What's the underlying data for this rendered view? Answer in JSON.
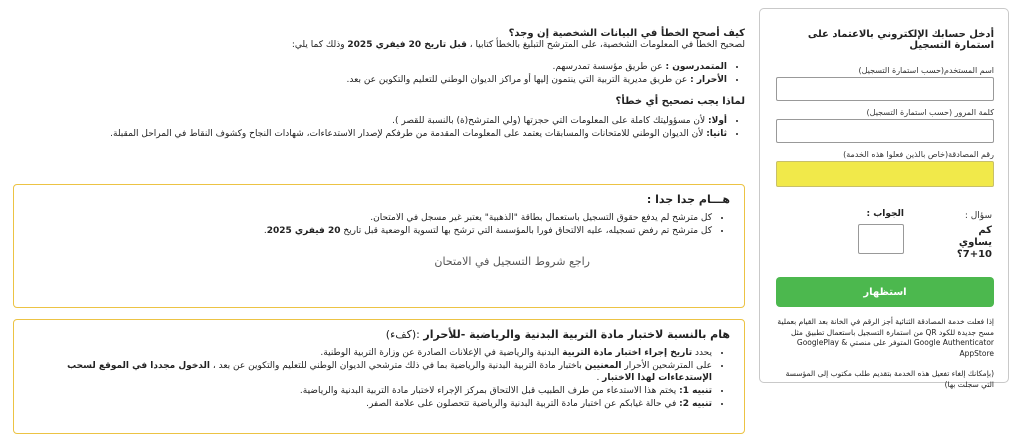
{
  "login": {
    "title": "أدخل حسابك الإلكتروني بالاعتماد على استمارة التسجيل",
    "username_label": "اسم المستخدم(حسب استمارة التسجيل)",
    "password_label": "كلمة المرور (حسب استمارة التسجيل)",
    "auth_label": "رقم المصادقة(خاص بالذين فعلوا هذه الخدمة)",
    "question_label": "سؤال :",
    "question_text": "كم يساوي 10+7؟",
    "answer_label": "الجواب :",
    "button_label": "استظهار",
    "note1": "إذا فعلت خدمة المصادقة الثنائية أجز الرقم في الخانة بعد القيام بعملية مسح جديدة للكود QR من استمارة التسجيل باستعمال تطبيق مثل Google Authenticator المتوفر على منصتي GooglePlay & AppStore",
    "note2": "(بإمكانك إلغاء تفعيل هذه الخدمة بتقديم طلب مكتوب إلى المؤسسة التي سجلت بها)"
  },
  "fix": {
    "heading": "كيف أصحح الخطأ في البيانات الشخصية إن وجد؟",
    "intro_a": "لصحيح الخطأ في المعلومات الشخصية، على المترشح التبليغ بالخطأ كتابيا ، ",
    "intro_b": "قبل تاريخ 20 فيفري 2025",
    "intro_c": " وذلك كما يلي:",
    "items": [
      {
        "bold": "المتمدرسون :",
        "text": " عن طريق مؤسسة تمدرسهم."
      },
      {
        "bold": "الأحرار :",
        "text": " عن طريق مديرية التربية التي ينتمون إليها أو مراكز الديوان الوطني للتعليم والتكوين عن بعد."
      }
    ]
  },
  "why": {
    "heading": "لماذا يجب تصحيح أي خطأ؟",
    "items": [
      {
        "bold": "أولا:",
        "text": " لأن مسؤوليتك كاملة على المعلومات التي حجزتها (ولي المترشح(ة) بالنسبة للقصر )."
      },
      {
        "bold": "ثانيا:",
        "text": " لأن الديوان الوطني للامتحانات والمسابقات يعتمد على المعلومات المقدمة من طرفكم لإصدار الاستدعاءات، شهادات النجاح وكشوف النقاط في المراحل المقبلة."
      }
    ]
  },
  "important": {
    "heading": "هـــام جدا جدا :",
    "item1": "كل مترشح لم يدفع حقوق التسجيل باستعمال بطاقة \"الذهبية\" يعتبر غير مسجل في الامتحان.",
    "item2_a": "كل مترشح تم رفض تسجيله، عليه الالتحاق فورا بالمؤسسة التي ترشح بها لتسوية الوضعية قبل تاريخ ",
    "item2_b": "20 فيفري 2025",
    "item2_c": ".",
    "ref_link": "راجع شروط التسجيل في الامتحان"
  },
  "pe": {
    "heading": "هام بالنسبة لاختبار مادة التربية البدنية والرياضية -للأحرار",
    "heading_suffix": " :(كفء)",
    "item1_a": "يحدد ",
    "item1_b": "تاريخ إجراء اختبار مادة التربية",
    "item1_c": " البدنية والرياضية في الإعلانات الصادرة عن وزارة التربية الوطنية.",
    "item2_a": "على المترشحين الأحرار ",
    "item2_b": "المعنيين",
    "item2_c": " باختبار مادة التربية البدنية والرياضية بما في ذلك مترشحي الديوان الوطني للتعليم والتكوين عن بعد ، ",
    "item2_d": "الدخول مجددا في الموقع لسحب الإستدعاءات لهذا الاختبار",
    "item2_e": " .",
    "item3_a": "تنبيه 1:",
    "item3_b": " يختم هذا الاستدعاء من طرف الطبيب قبل الالتحاق بمركز الإجراء لاختبار مادة التربية البدنية والرياضية.",
    "item4_a": "تنبيه 2:",
    "item4_b": " في حالة غيابكم عن اختبار مادة التربية البدنية والرياضية تتحصلون على علامة الصفر."
  }
}
